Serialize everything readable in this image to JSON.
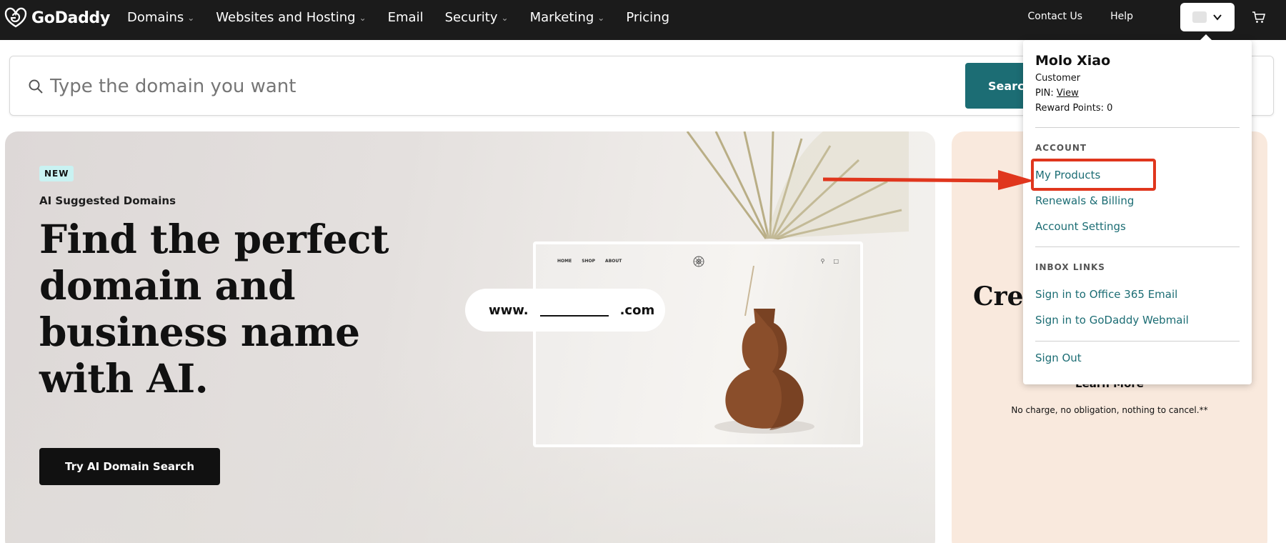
{
  "brand": {
    "name": "GoDaddy"
  },
  "nav": {
    "items": [
      {
        "label": "Domains",
        "has_menu": true
      },
      {
        "label": "Websites and Hosting",
        "has_menu": true
      },
      {
        "label": "Email",
        "has_menu": false
      },
      {
        "label": "Security",
        "has_menu": true
      },
      {
        "label": "Marketing",
        "has_menu": true
      },
      {
        "label": "Pricing",
        "has_menu": false
      }
    ],
    "contact_label": "Contact Us",
    "help_label": "Help"
  },
  "search": {
    "placeholder": "Type the domain you want",
    "button_label": "Search"
  },
  "hero": {
    "badge": "NEW",
    "subtitle": "AI Suggested Domains",
    "title": "Find the perfect domain and business name with AI.",
    "cta_label": "Try AI Domain Search",
    "mockup": {
      "nav_links": [
        "HOME",
        "SHOP",
        "ABOUT"
      ],
      "url_prefix": "www.",
      "url_suffix": ".com"
    }
  },
  "side_card": {
    "title_visible": "Crea",
    "learn_more": "Learn More",
    "fine_print": "No charge, no obligation, nothing to cancel.**"
  },
  "account_menu": {
    "user_name": "Molo Xiao",
    "customer_label": "Customer",
    "customer_value": "",
    "pin_label": "PIN:",
    "pin_link": "View",
    "reward_points": "Reward Points: 0",
    "account_section": {
      "heading": "ACCOUNT",
      "links": [
        "My Products",
        "Renewals & Billing",
        "Account Settings"
      ]
    },
    "inbox_section": {
      "heading": "INBOX LINKS",
      "links": [
        "Sign in to Office 365 Email",
        "Sign in to GoDaddy Webmail"
      ]
    },
    "sign_out": "Sign Out"
  },
  "colors": {
    "nav_bg": "#1b1b1b",
    "accent_teal": "#1c6d74",
    "highlight_red": "#e0361d",
    "side_card_bg": "#f9e9dd"
  }
}
